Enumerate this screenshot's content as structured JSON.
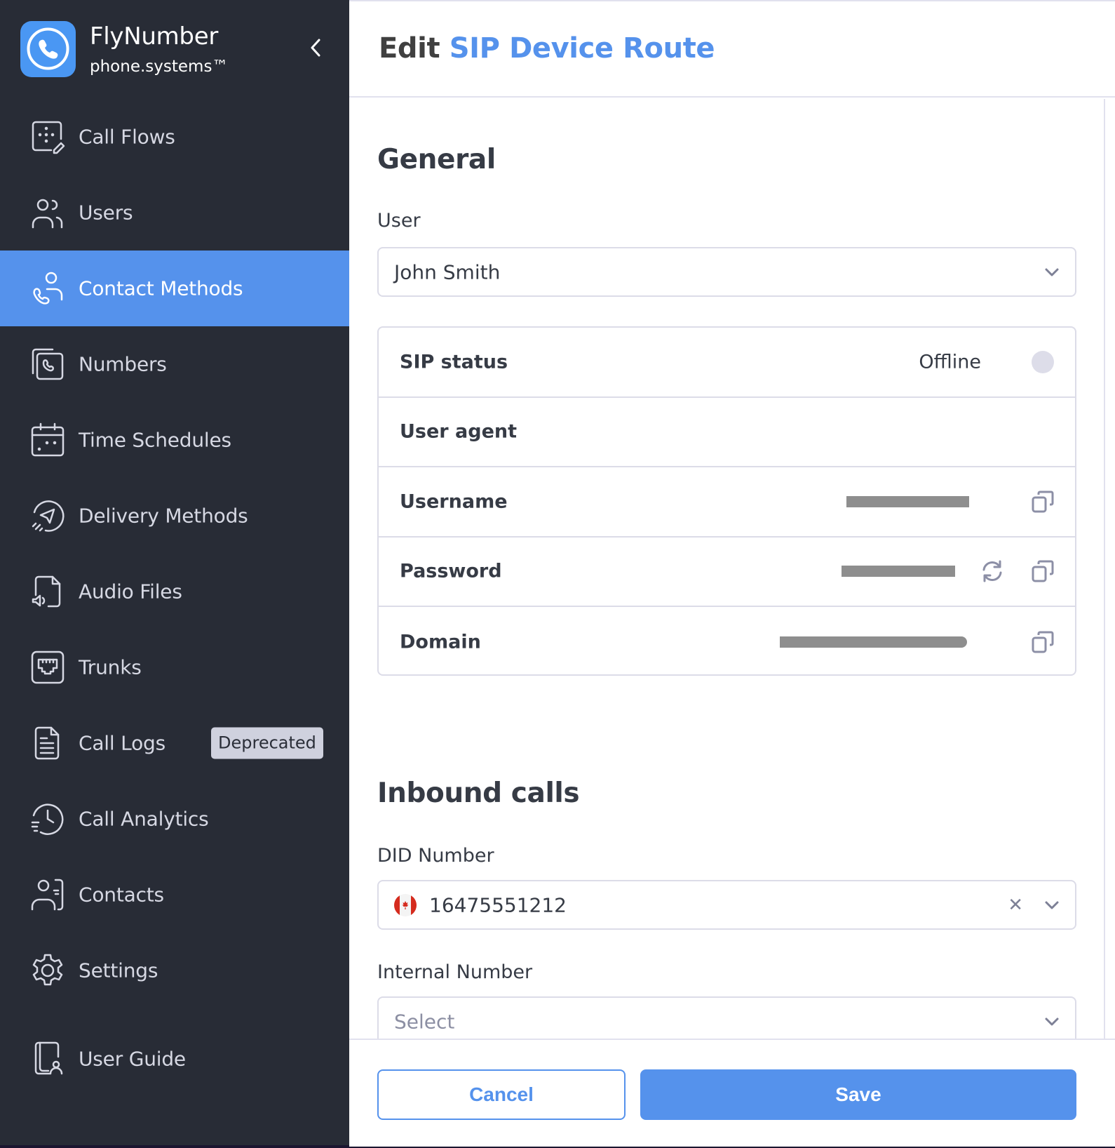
{
  "brand": {
    "name": "FlyNumber",
    "subtitle": "phone.systems™",
    "color": "#4a97f3"
  },
  "sidebar": {
    "active_color": "#5592ec",
    "items": [
      {
        "label": "Call Flows",
        "icon": "call-flows-icon",
        "active": false
      },
      {
        "label": "Users",
        "icon": "users-icon",
        "active": false
      },
      {
        "label": "Contact Methods",
        "icon": "contact-methods-icon",
        "active": true
      },
      {
        "label": "Numbers",
        "icon": "numbers-icon",
        "active": false
      },
      {
        "label": "Time Schedules",
        "icon": "calendar-icon",
        "active": false
      },
      {
        "label": "Delivery Methods",
        "icon": "paper-plane-icon",
        "active": false
      },
      {
        "label": "Audio Files",
        "icon": "audio-file-icon",
        "active": false
      },
      {
        "label": "Trunks",
        "icon": "ethernet-port-icon",
        "active": false
      },
      {
        "label": "Call Logs",
        "icon": "document-icon",
        "active": false,
        "badge": "Deprecated"
      },
      {
        "label": "Call Analytics",
        "icon": "clock-history-icon",
        "active": false
      },
      {
        "label": "Contacts",
        "icon": "contact-card-icon",
        "active": false
      },
      {
        "label": "Settings",
        "icon": "gear-icon",
        "active": false
      },
      {
        "label": "User Guide",
        "icon": "book-user-icon",
        "active": false
      }
    ]
  },
  "header": {
    "title_prefix": "Edit",
    "title_accent": "SIP Device Route"
  },
  "general": {
    "title": "General",
    "user_label": "User",
    "user_value": "John Smith",
    "sip": {
      "status_label": "SIP status",
      "status_value": "Offline",
      "user_agent_label": "User agent",
      "user_agent_value": "",
      "username_label": "Username",
      "password_label": "Password",
      "domain_label": "Domain",
      "values_redacted": true
    }
  },
  "inbound": {
    "title": "Inbound calls",
    "did_label": "DID Number",
    "did_value": "16475551212",
    "did_country": "CA",
    "internal_label": "Internal Number",
    "internal_placeholder": "Select"
  },
  "footer": {
    "cancel_label": "Cancel",
    "save_label": "Save"
  }
}
